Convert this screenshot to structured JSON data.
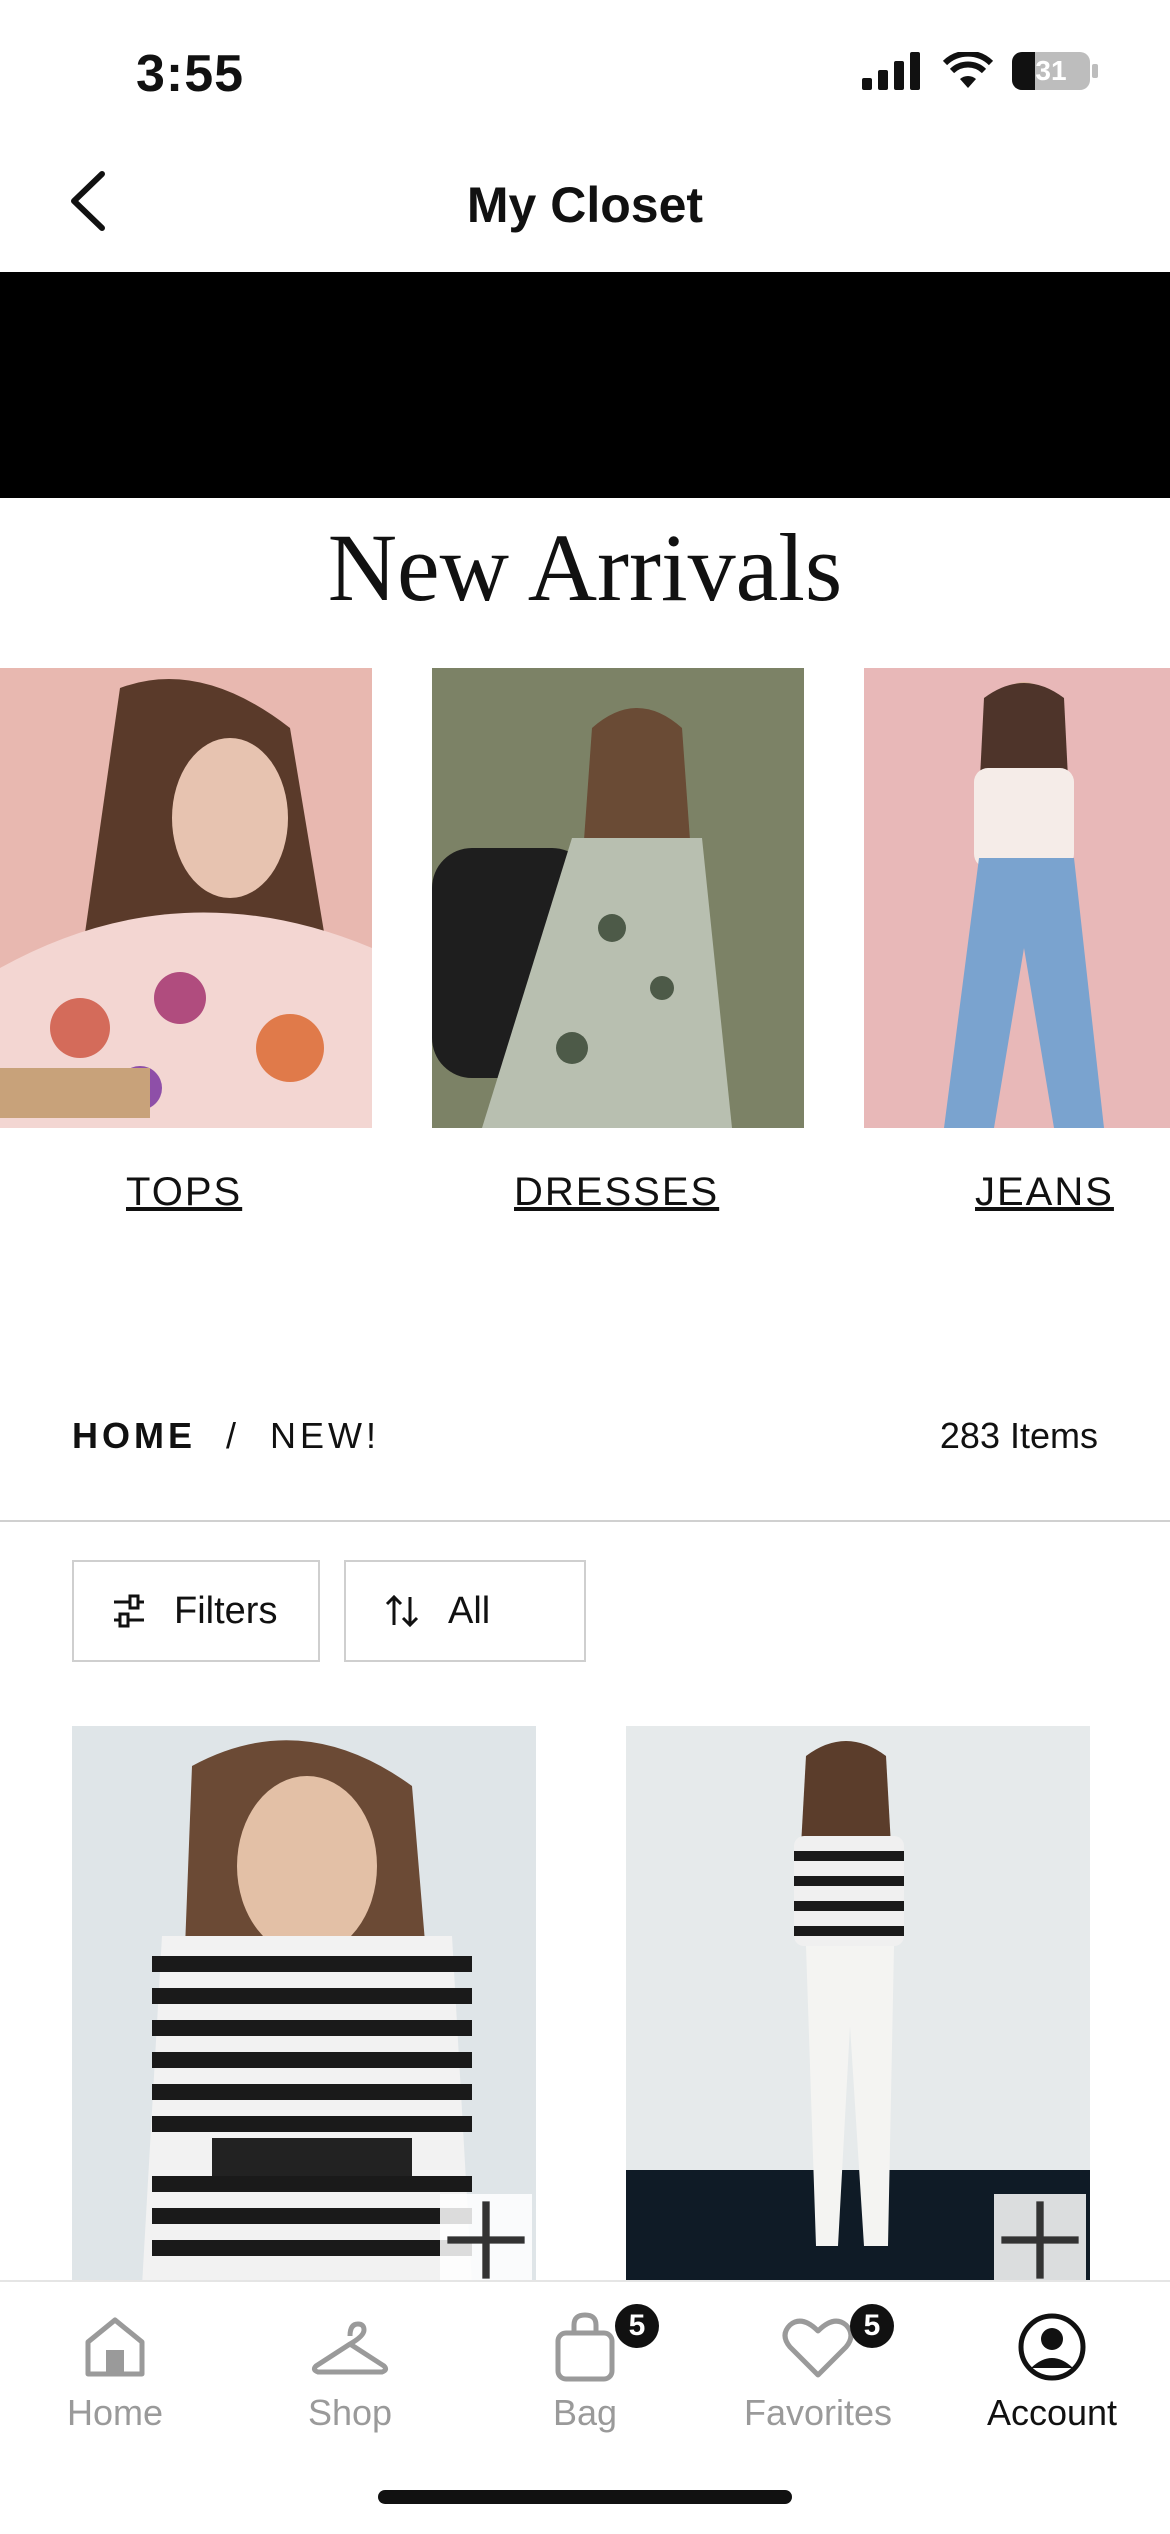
{
  "status_bar": {
    "time": "3:55",
    "battery": "31"
  },
  "header": {
    "title": "My Closet"
  },
  "section": {
    "title": "New Arrivals"
  },
  "categories": [
    {
      "label": "TOPS"
    },
    {
      "label": "DRESSES"
    },
    {
      "label": "JEANS"
    }
  ],
  "breadcrumb": {
    "home": "HOME",
    "separator": "/",
    "current": "NEW!"
  },
  "results": {
    "count": "283 Items"
  },
  "toolbar": {
    "filters_label": "Filters",
    "sort_label": "All"
  },
  "tabbar": {
    "home": "Home",
    "shop": "Shop",
    "bag": "Bag",
    "bag_badge": "5",
    "favorites": "Favorites",
    "favorites_badge": "5",
    "account": "Account"
  },
  "colors": {
    "accent": "#000000",
    "inactive": "#9a9a9a"
  }
}
